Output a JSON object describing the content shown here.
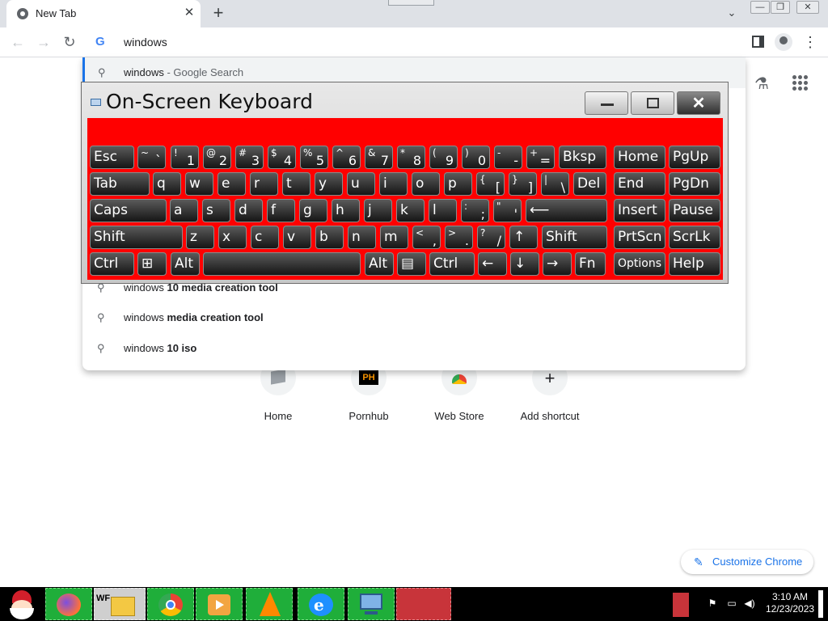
{
  "browser": {
    "tab": {
      "title": "New Tab",
      "close": "✕"
    },
    "new_tab": "+",
    "tab_search": "⌄",
    "window_controls": {
      "minimize": "—",
      "restore": "❐",
      "close": "✕"
    },
    "nav": {
      "back": "←",
      "forward": "→",
      "reload": "↻"
    },
    "omnibox": {
      "text": "windows"
    },
    "menu": "⋮"
  },
  "suggestions": {
    "first": {
      "query": "windows",
      "suffix": " - Google Search"
    },
    "visible": [
      {
        "prefix": "windows ",
        "bold": "10 media creation tool"
      },
      {
        "prefix": "windows ",
        "bold": "media creation tool"
      },
      {
        "prefix": "windows ",
        "bold": "10 iso"
      }
    ]
  },
  "ntp": {
    "shortcuts": [
      {
        "label": "Home",
        "icon": "home-app-icon"
      },
      {
        "label": "Pornhub",
        "icon": "ph-icon",
        "icon_text": "PH"
      },
      {
        "label": "Web Store",
        "icon": "chrome-web-store-icon"
      },
      {
        "label": "Add shortcut",
        "icon": "plus-icon",
        "icon_text": "+"
      }
    ],
    "customize_label": "Customize Chrome"
  },
  "osk": {
    "title": "On-Screen Keyboard",
    "background_color": "#ff0000",
    "rows": [
      [
        {
          "label": "Esc"
        },
        {
          "sec": "~",
          "pri": "`"
        },
        {
          "sec": "!",
          "pri": "1"
        },
        {
          "sec": "@",
          "pri": "2"
        },
        {
          "sec": "#",
          "pri": "3"
        },
        {
          "sec": "$",
          "pri": "4"
        },
        {
          "sec": "%",
          "pri": "5"
        },
        {
          "sec": "^",
          "pri": "6"
        },
        {
          "sec": "&",
          "pri": "7"
        },
        {
          "sec": "*",
          "pri": "8"
        },
        {
          "sec": "(",
          "pri": "9"
        },
        {
          "sec": ")",
          "pri": "0"
        },
        {
          "sec": "-",
          "pri": "-"
        },
        {
          "sec": "+",
          "pri": "="
        },
        {
          "label": "Bksp"
        },
        {
          "label": "Home"
        },
        {
          "label": "PgUp"
        }
      ],
      [
        {
          "label": "Tab"
        },
        {
          "label": "q"
        },
        {
          "label": "w"
        },
        {
          "label": "e"
        },
        {
          "label": "r"
        },
        {
          "label": "t"
        },
        {
          "label": "y"
        },
        {
          "label": "u"
        },
        {
          "label": "i"
        },
        {
          "label": "o"
        },
        {
          "label": "p"
        },
        {
          "sec": "{",
          "pri": "["
        },
        {
          "sec": "}",
          "pri": "]"
        },
        {
          "sec": "|",
          "pri": "\\"
        },
        {
          "label": "Del"
        },
        {
          "label": "End"
        },
        {
          "label": "PgDn"
        }
      ],
      [
        {
          "label": "Caps"
        },
        {
          "label": "a"
        },
        {
          "label": "s"
        },
        {
          "label": "d"
        },
        {
          "label": "f"
        },
        {
          "label": "g"
        },
        {
          "label": "h"
        },
        {
          "label": "j"
        },
        {
          "label": "k"
        },
        {
          "label": "l"
        },
        {
          "sec": ":",
          "pri": ";"
        },
        {
          "sec": "\"",
          "pri": "'"
        },
        {
          "label": "⟵"
        },
        {
          "label": "Insert"
        },
        {
          "label": "Pause"
        }
      ],
      [
        {
          "label": "Shift"
        },
        {
          "label": "z"
        },
        {
          "label": "x"
        },
        {
          "label": "c"
        },
        {
          "label": "v"
        },
        {
          "label": "b"
        },
        {
          "label": "n"
        },
        {
          "label": "m"
        },
        {
          "sec": "<",
          "pri": ","
        },
        {
          "sec": ">",
          "pri": "."
        },
        {
          "sec": "?",
          "pri": "/"
        },
        {
          "label": "↑"
        },
        {
          "label": "Shift"
        },
        {
          "label": "PrtScn"
        },
        {
          "label": "ScrLk"
        }
      ],
      [
        {
          "label": "Ctrl"
        },
        {
          "label": "⊞"
        },
        {
          "label": "Alt"
        },
        {
          "label": ""
        },
        {
          "label": "Alt"
        },
        {
          "label": "▤"
        },
        {
          "label": "Ctrl"
        },
        {
          "label": "←"
        },
        {
          "label": "↓"
        },
        {
          "label": "→"
        },
        {
          "label": "Fn"
        },
        {
          "label": "Options"
        },
        {
          "label": "Help"
        }
      ]
    ]
  },
  "taskbar": {
    "clock_time": "3:10 AM",
    "clock_date": "12/23/2023",
    "accent": "#1fae3a"
  }
}
